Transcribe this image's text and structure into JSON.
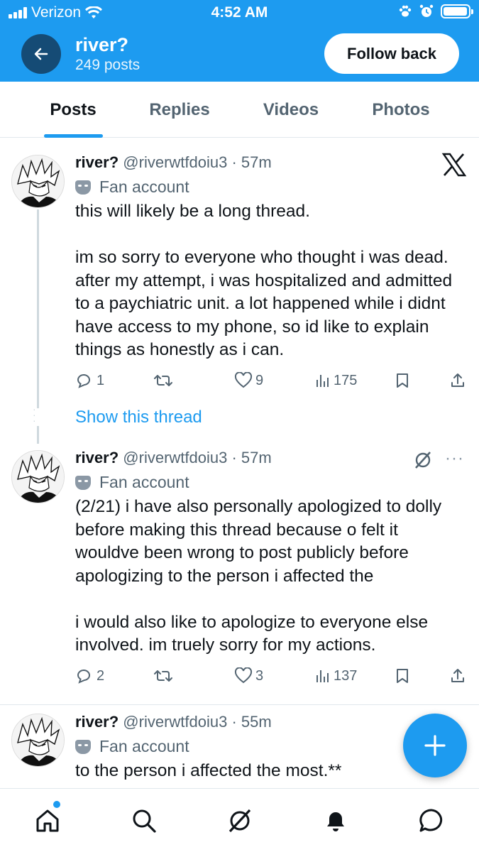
{
  "status_bar": {
    "carrier": "Verizon",
    "time": "4:52 AM"
  },
  "header": {
    "name": "river?",
    "post_count": "249 posts",
    "follow_label": "Follow back"
  },
  "tabs": [
    {
      "label": "Posts",
      "active": true
    },
    {
      "label": "Replies",
      "active": false
    },
    {
      "label": "Videos",
      "active": false
    },
    {
      "label": "Photos",
      "active": false
    }
  ],
  "tweets": [
    {
      "name": "river?",
      "handle": "@riverwtfdoiu3",
      "sep": "·",
      "time": "57m",
      "badge": "Fan account",
      "text": "this will likely be a long thread.\n\nim so sorry to everyone who thought i was dead. after my attempt, i was hospitalized and admitted to a paychiatric unit. a lot happened while i didnt have access to my phone, so id like to explain things as honestly as i can.",
      "replies": "1",
      "retweets": "",
      "likes": "9",
      "views": "175"
    },
    {
      "name": "river?",
      "handle": "@riverwtfdoiu3",
      "sep": "·",
      "time": "57m",
      "badge": "Fan account",
      "text": "(2/21) i have also personally apologized to dolly before making this thread because o felt it wouldve been wrong to post publicly before apologizing to the person i affected the\n\ni would also like to apologize to everyone else involved. im truely sorry for my actions.",
      "replies": "2",
      "retweets": "",
      "likes": "3",
      "views": "137"
    },
    {
      "name": "river?",
      "handle": "@riverwtfdoiu3",
      "sep": "·",
      "time": "55m",
      "badge": "Fan account",
      "text": "to the person i affected the most.**"
    }
  ],
  "show_thread_label": "Show this thread",
  "colors": {
    "accent": "#1d9bf0",
    "text": "#0f1419",
    "secondary": "#536471",
    "back_button": "#154b75"
  },
  "icons": {
    "tweet1_brand": "x-logo-icon",
    "tweet2_menu": "grok-icon",
    "nav": [
      "home-icon",
      "search-icon",
      "grok-icon",
      "bell-icon",
      "messages-icon"
    ],
    "fab": "plus-icon"
  }
}
